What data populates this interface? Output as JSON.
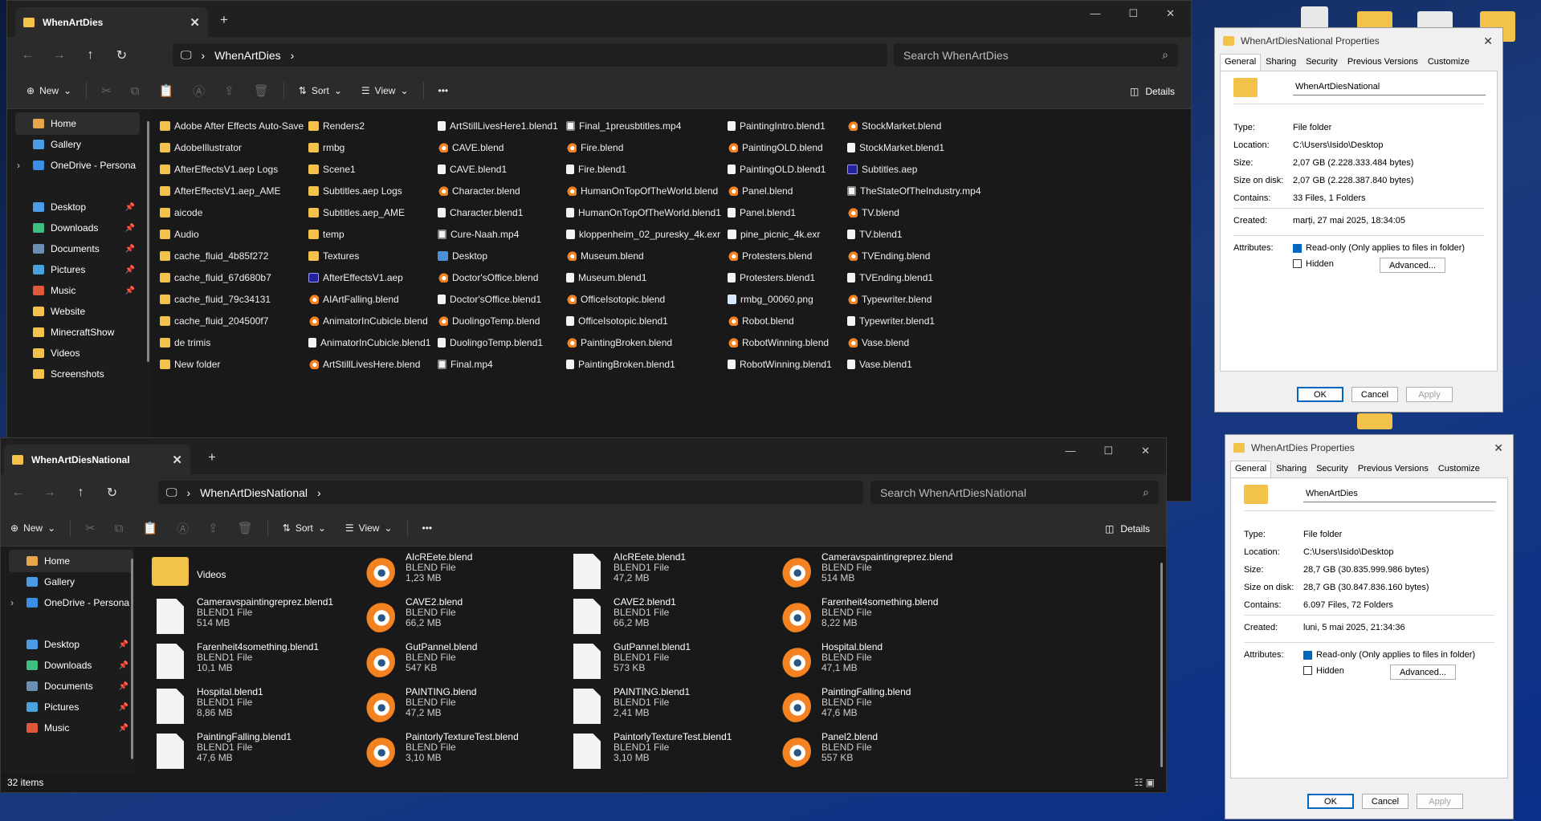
{
  "colors": {
    "folder": "#f2c24b",
    "blender": "#f58220",
    "accent": "#0067c0"
  },
  "w1": {
    "tab": "WhenArtDies",
    "path": "WhenArtDies",
    "search": "Search WhenArtDies",
    "cmd": {
      "new": "New",
      "sort": "Sort",
      "view": "View",
      "details": "Details"
    },
    "sidebar": [
      "Home",
      "Gallery",
      "OneDrive - Persona",
      "Desktop",
      "Downloads",
      "Documents",
      "Pictures",
      "Music",
      "Website",
      "MinecraftShow",
      "Videos",
      "Screenshots"
    ],
    "cols": [
      [
        [
          "folder",
          "Adobe After Effects Auto-Save"
        ],
        [
          "folder",
          "AdobeIllustrator"
        ],
        [
          "folder",
          "AfterEffectsV1.aep Logs"
        ],
        [
          "folder",
          "AfterEffectsV1.aep_AME"
        ],
        [
          "folder",
          "aicode"
        ],
        [
          "folder",
          "Audio"
        ],
        [
          "folder",
          "cache_fluid_4b85f272"
        ],
        [
          "folder",
          "cache_fluid_67d680b7"
        ],
        [
          "folder",
          "cache_fluid_79c34131"
        ],
        [
          "folder",
          "cache_fluid_204500f7"
        ],
        [
          "folder",
          "de trimis"
        ],
        [
          "folder",
          "New folder"
        ]
      ],
      [
        [
          "folder",
          "Renders2"
        ],
        [
          "folder",
          "rmbg"
        ],
        [
          "folder",
          "Scene1"
        ],
        [
          "folder",
          "Subtitles.aep Logs"
        ],
        [
          "folder",
          "Subtitles.aep_AME"
        ],
        [
          "folder",
          "temp"
        ],
        [
          "folder",
          "Textures"
        ],
        [
          "aep",
          "AfterEffectsV1.aep"
        ],
        [
          "blend",
          "AIArtFalling.blend"
        ],
        [
          "blend",
          "AnimatorInCubicle.blend"
        ],
        [
          "file",
          "AnimatorInCubicle.blend1"
        ],
        [
          "blend",
          "ArtStillLivesHere.blend"
        ]
      ],
      [
        [
          "file",
          "ArtStillLivesHere1.blend1"
        ],
        [
          "blend",
          "CAVE.blend"
        ],
        [
          "file",
          "CAVE.blend1"
        ],
        [
          "blend",
          "Character.blend"
        ],
        [
          "file",
          "Character.blend1"
        ],
        [
          "mp4",
          "Cure-Naah.mp4"
        ],
        [
          "desk",
          "Desktop"
        ],
        [
          "blend",
          "Doctor'sOffice.blend"
        ],
        [
          "file",
          "Doctor'sOffice.blend1"
        ],
        [
          "blend",
          "DuolingoTemp.blend"
        ],
        [
          "file",
          "DuolingoTemp.blend1"
        ],
        [
          "mp4",
          "Final.mp4"
        ]
      ],
      [
        [
          "mp4",
          "Final_1preusbtitles.mp4"
        ],
        [
          "blend",
          "Fire.blend"
        ],
        [
          "file",
          "Fire.blend1"
        ],
        [
          "blend",
          "HumanOnTopOfTheWorld.blend"
        ],
        [
          "file",
          "HumanOnTopOfTheWorld.blend1"
        ],
        [
          "exr",
          "kloppenheim_02_puresky_4k.exr"
        ],
        [
          "blend",
          "Museum.blend"
        ],
        [
          "file",
          "Museum.blend1"
        ],
        [
          "blend",
          "OfficeIsotopic.blend"
        ],
        [
          "file",
          "OfficeIsotopic.blend1"
        ],
        [
          "blend",
          "PaintingBroken.blend"
        ],
        [
          "file",
          "PaintingBroken.blend1"
        ]
      ],
      [
        [
          "file",
          "PaintingIntro.blend1"
        ],
        [
          "blend",
          "PaintingOLD.blend"
        ],
        [
          "file",
          "PaintingOLD.blend1"
        ],
        [
          "blend",
          "Panel.blend"
        ],
        [
          "file",
          "Panel.blend1"
        ],
        [
          "exr",
          "pine_picnic_4k.exr"
        ],
        [
          "blend",
          "Protesters.blend"
        ],
        [
          "file",
          "Protesters.blend1"
        ],
        [
          "png",
          "rmbg_00060.png"
        ],
        [
          "blend",
          "Robot.blend"
        ],
        [
          "blend",
          "RobotWinning.blend"
        ],
        [
          "file",
          "RobotWinning.blend1"
        ]
      ],
      [
        [
          "blend",
          "StockMarket.blend"
        ],
        [
          "file",
          "StockMarket.blend1"
        ],
        [
          "aep",
          "Subtitles.aep"
        ],
        [
          "mp4",
          "TheStateOfTheIndustry.mp4"
        ],
        [
          "blend",
          "TV.blend"
        ],
        [
          "file",
          "TV.blend1"
        ],
        [
          "blend",
          "TVEnding.blend"
        ],
        [
          "file",
          "TVEnding.blend1"
        ],
        [
          "blend",
          "Typewriter.blend"
        ],
        [
          "file",
          "Typewriter.blend1"
        ],
        [
          "blend",
          "Vase.blend"
        ],
        [
          "file",
          "Vase.blend1"
        ]
      ]
    ]
  },
  "w2": {
    "tab": "WhenArtDiesNational",
    "path": "WhenArtDiesNational",
    "search": "Search WhenArtDiesNational",
    "cmd": {
      "new": "New",
      "sort": "Sort",
      "view": "View",
      "details": "Details"
    },
    "sidebar": [
      "Home",
      "Gallery",
      "OneDrive - Persona",
      "Desktop",
      "Downloads",
      "Documents",
      "Pictures",
      "Music"
    ],
    "status": "32 items",
    "tiles": [
      [
        "folder",
        "Videos",
        "",
        ""
      ],
      [
        "blend",
        "AIcREete.blend",
        "BLEND File",
        "1,23 MB"
      ],
      [
        "file",
        "AIcREete.blend1",
        "BLEND1 File",
        "47,2 MB"
      ],
      [
        "blend",
        "Cameravspaintingreprez.blend",
        "BLEND File",
        "514 MB"
      ],
      [
        "file",
        "Cameravspaintingreprez.blend1",
        "BLEND1 File",
        "514 MB"
      ],
      [
        "blend",
        "CAVE2.blend",
        "BLEND File",
        "66,2 MB"
      ],
      [
        "file",
        "CAVE2.blend1",
        "BLEND1 File",
        "66,2 MB"
      ],
      [
        "blend",
        "Farenheit4something.blend",
        "BLEND File",
        "8,22 MB"
      ],
      [
        "file",
        "Farenheit4something.blend1",
        "BLEND1 File",
        "10,1 MB"
      ],
      [
        "blend",
        "GutPannel.blend",
        "BLEND File",
        "547 KB"
      ],
      [
        "file",
        "GutPannel.blend1",
        "BLEND1 File",
        "573 KB"
      ],
      [
        "blend",
        "Hospital.blend",
        "BLEND File",
        "47,1 MB"
      ],
      [
        "file",
        "Hospital.blend1",
        "BLEND1 File",
        "8,86 MB"
      ],
      [
        "blend",
        "PAINTING.blend",
        "BLEND File",
        "47,2 MB"
      ],
      [
        "file",
        "PAINTING.blend1",
        "BLEND1 File",
        "2,41 MB"
      ],
      [
        "blend",
        "PaintingFalling.blend",
        "BLEND File",
        "47,6 MB"
      ],
      [
        "file",
        "PaintingFalling.blend1",
        "BLEND1 File",
        "47,6 MB"
      ],
      [
        "blend",
        "PaintorlyTextureTest.blend",
        "BLEND File",
        "3,10 MB"
      ],
      [
        "file",
        "PaintorlyTextureTest.blend1",
        "BLEND1 File",
        "3,10 MB"
      ],
      [
        "blend",
        "Panel2.blend",
        "BLEND File",
        "557 KB"
      ]
    ]
  },
  "p1": {
    "title": "WhenArtDiesNational Properties",
    "tabs": [
      "General",
      "Sharing",
      "Security",
      "Previous Versions",
      "Customize"
    ],
    "name": "WhenArtDiesNational",
    "type": "File folder",
    "location": "C:\\Users\\Isido\\Desktop",
    "size": "2,07 GB (2.228.333.484 bytes)",
    "sizeondisk": "2,07 GB (2.228.387.840 bytes)",
    "contains": "33 Files, 1 Folders",
    "created": "marți, 27 mai 2025, 18:34:05",
    "labels": {
      "type": "Type:",
      "location": "Location:",
      "size": "Size:",
      "sod": "Size on disk:",
      "contains": "Contains:",
      "created": "Created:",
      "attrs": "Attributes:"
    },
    "readonly": "Read-only (Only applies to files in folder)",
    "hidden": "Hidden",
    "advanced": "Advanced...",
    "ok": "OK",
    "cancel": "Cancel",
    "apply": "Apply"
  },
  "p2": {
    "title": "WhenArtDies Properties",
    "tabs": [
      "General",
      "Sharing",
      "Security",
      "Previous Versions",
      "Customize"
    ],
    "name": "WhenArtDies",
    "type": "File folder",
    "location": "C:\\Users\\Isido\\Desktop",
    "size": "28,7 GB (30.835.999.986 bytes)",
    "sizeondisk": "28,7 GB (30.847.836.160 bytes)",
    "contains": "6.097 Files, 72 Folders",
    "created": "luni, 5 mai 2025, 21:34:36",
    "labels": {
      "type": "Type:",
      "location": "Location:",
      "size": "Size:",
      "sod": "Size on disk:",
      "contains": "Contains:",
      "created": "Created:",
      "attrs": "Attributes:"
    },
    "readonly": "Read-only (Only applies to files in folder)",
    "hidden": "Hidden",
    "advanced": "Advanced...",
    "ok": "OK",
    "cancel": "Cancel",
    "apply": "Apply"
  }
}
